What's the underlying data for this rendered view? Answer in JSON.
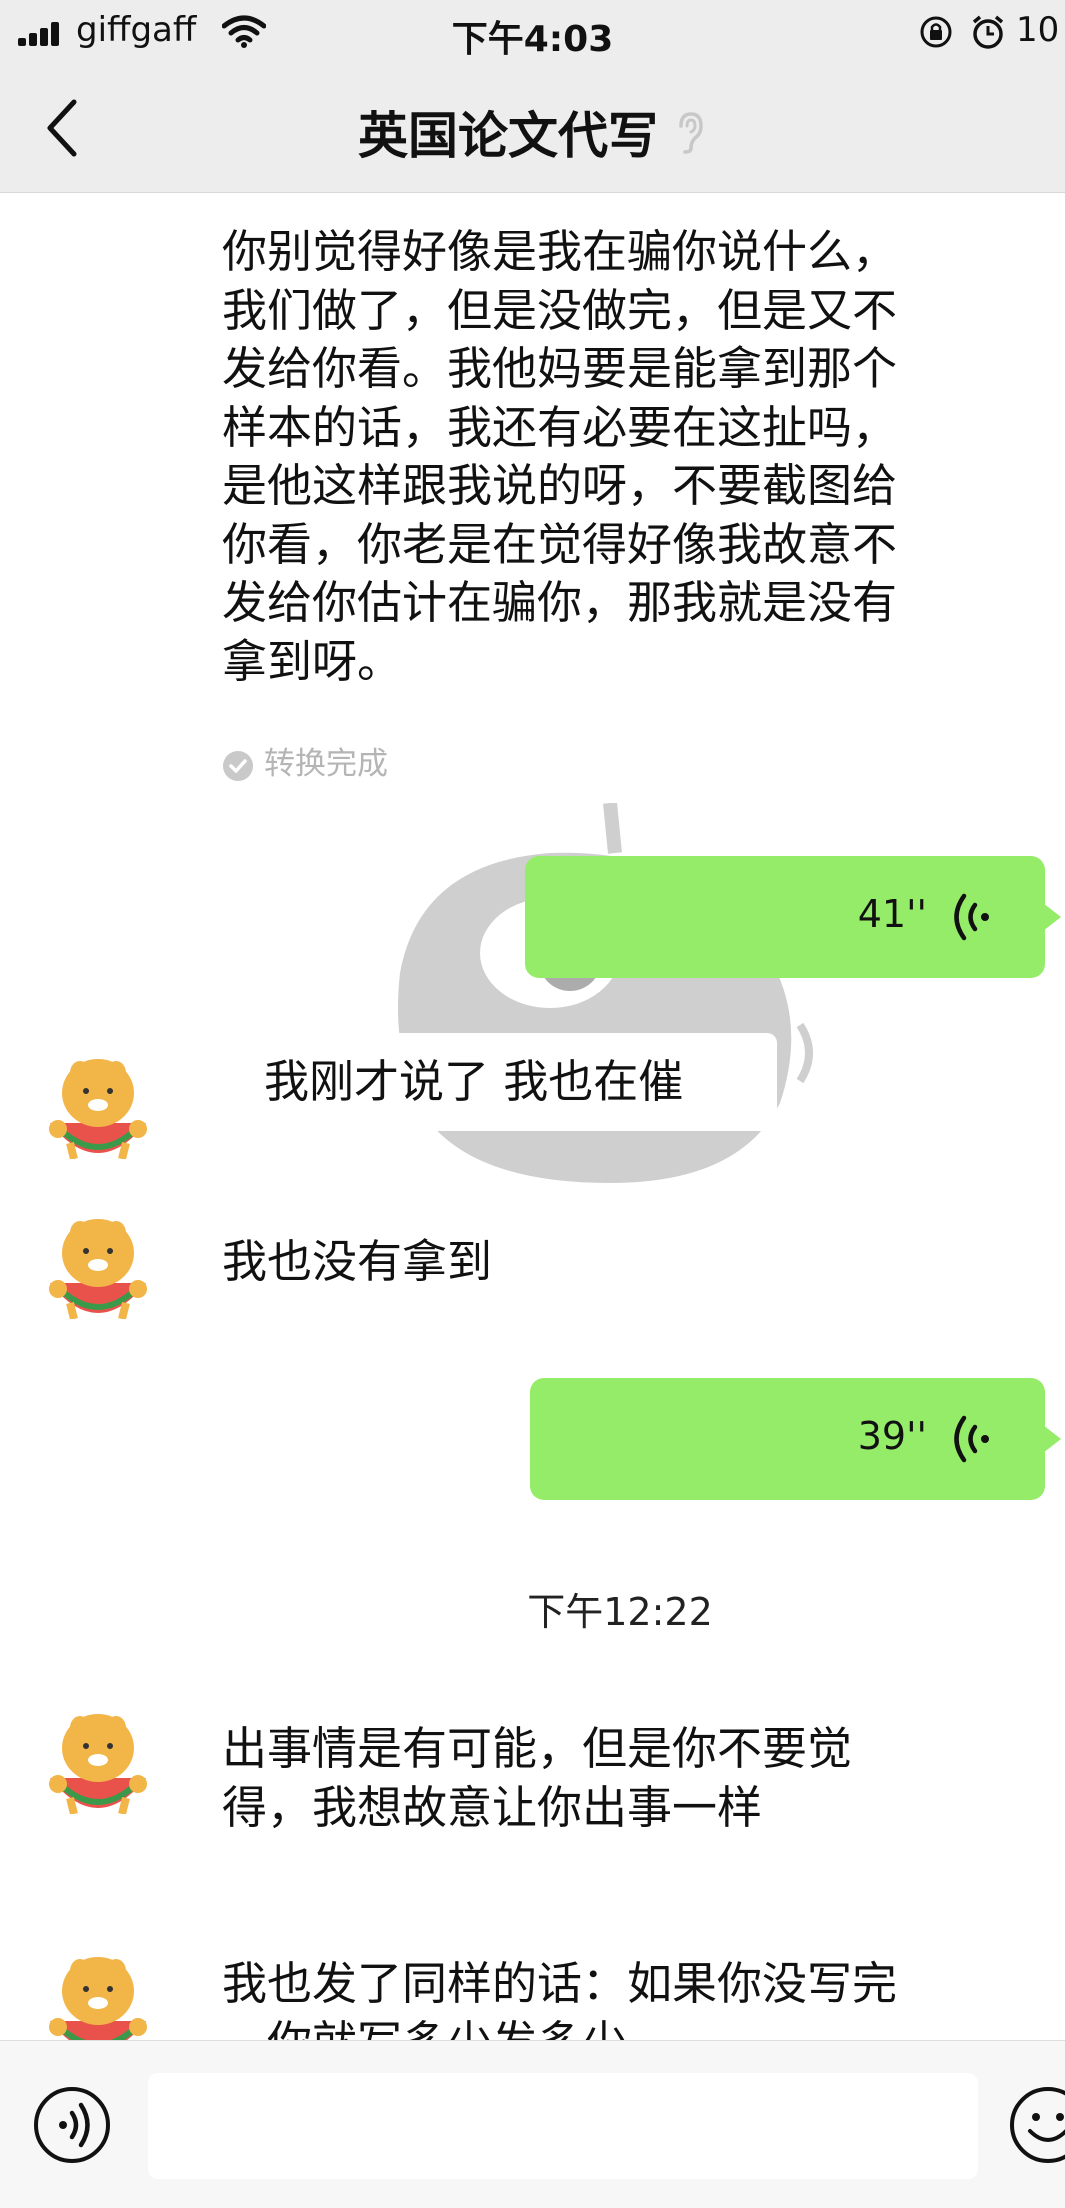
{
  "status_bar": {
    "carrier": "giffgaff",
    "time": "下午4:03",
    "battery": "10"
  },
  "nav": {
    "title": "英国论文代写"
  },
  "messages": {
    "m1_lines": [
      "你别觉得好像是我在骗你说什么，",
      "我们做了，但是没做完，但是又不",
      "发给你看。我他妈要是能拿到那个",
      "样本的话，我还有必要在这扯吗，",
      "是他这样跟我说的呀，不要截图给",
      "你看，你老是在觉得好像我故意不",
      "发给你估计在骗你，那我就是没有",
      "拿到呀。"
    ],
    "m1_status": "转换完成",
    "voice1_duration": "41''",
    "m2": "我刚才说了 我也在催",
    "m3": "我也没有拿到",
    "voice2_duration": "39''",
    "timestamp": "下午12:22",
    "m4_lines": [
      "出事情是有可能，但是你不要觉",
      "得，我想故意让你出事一样"
    ],
    "m5_lines": [
      "我也发了同样的话：如果你没写完",
      "，你就写多少发多少"
    ]
  },
  "colors": {
    "header_bg": "#ededed",
    "sent_bubble": "#95ec69",
    "chat_bg": "#ffffff"
  }
}
